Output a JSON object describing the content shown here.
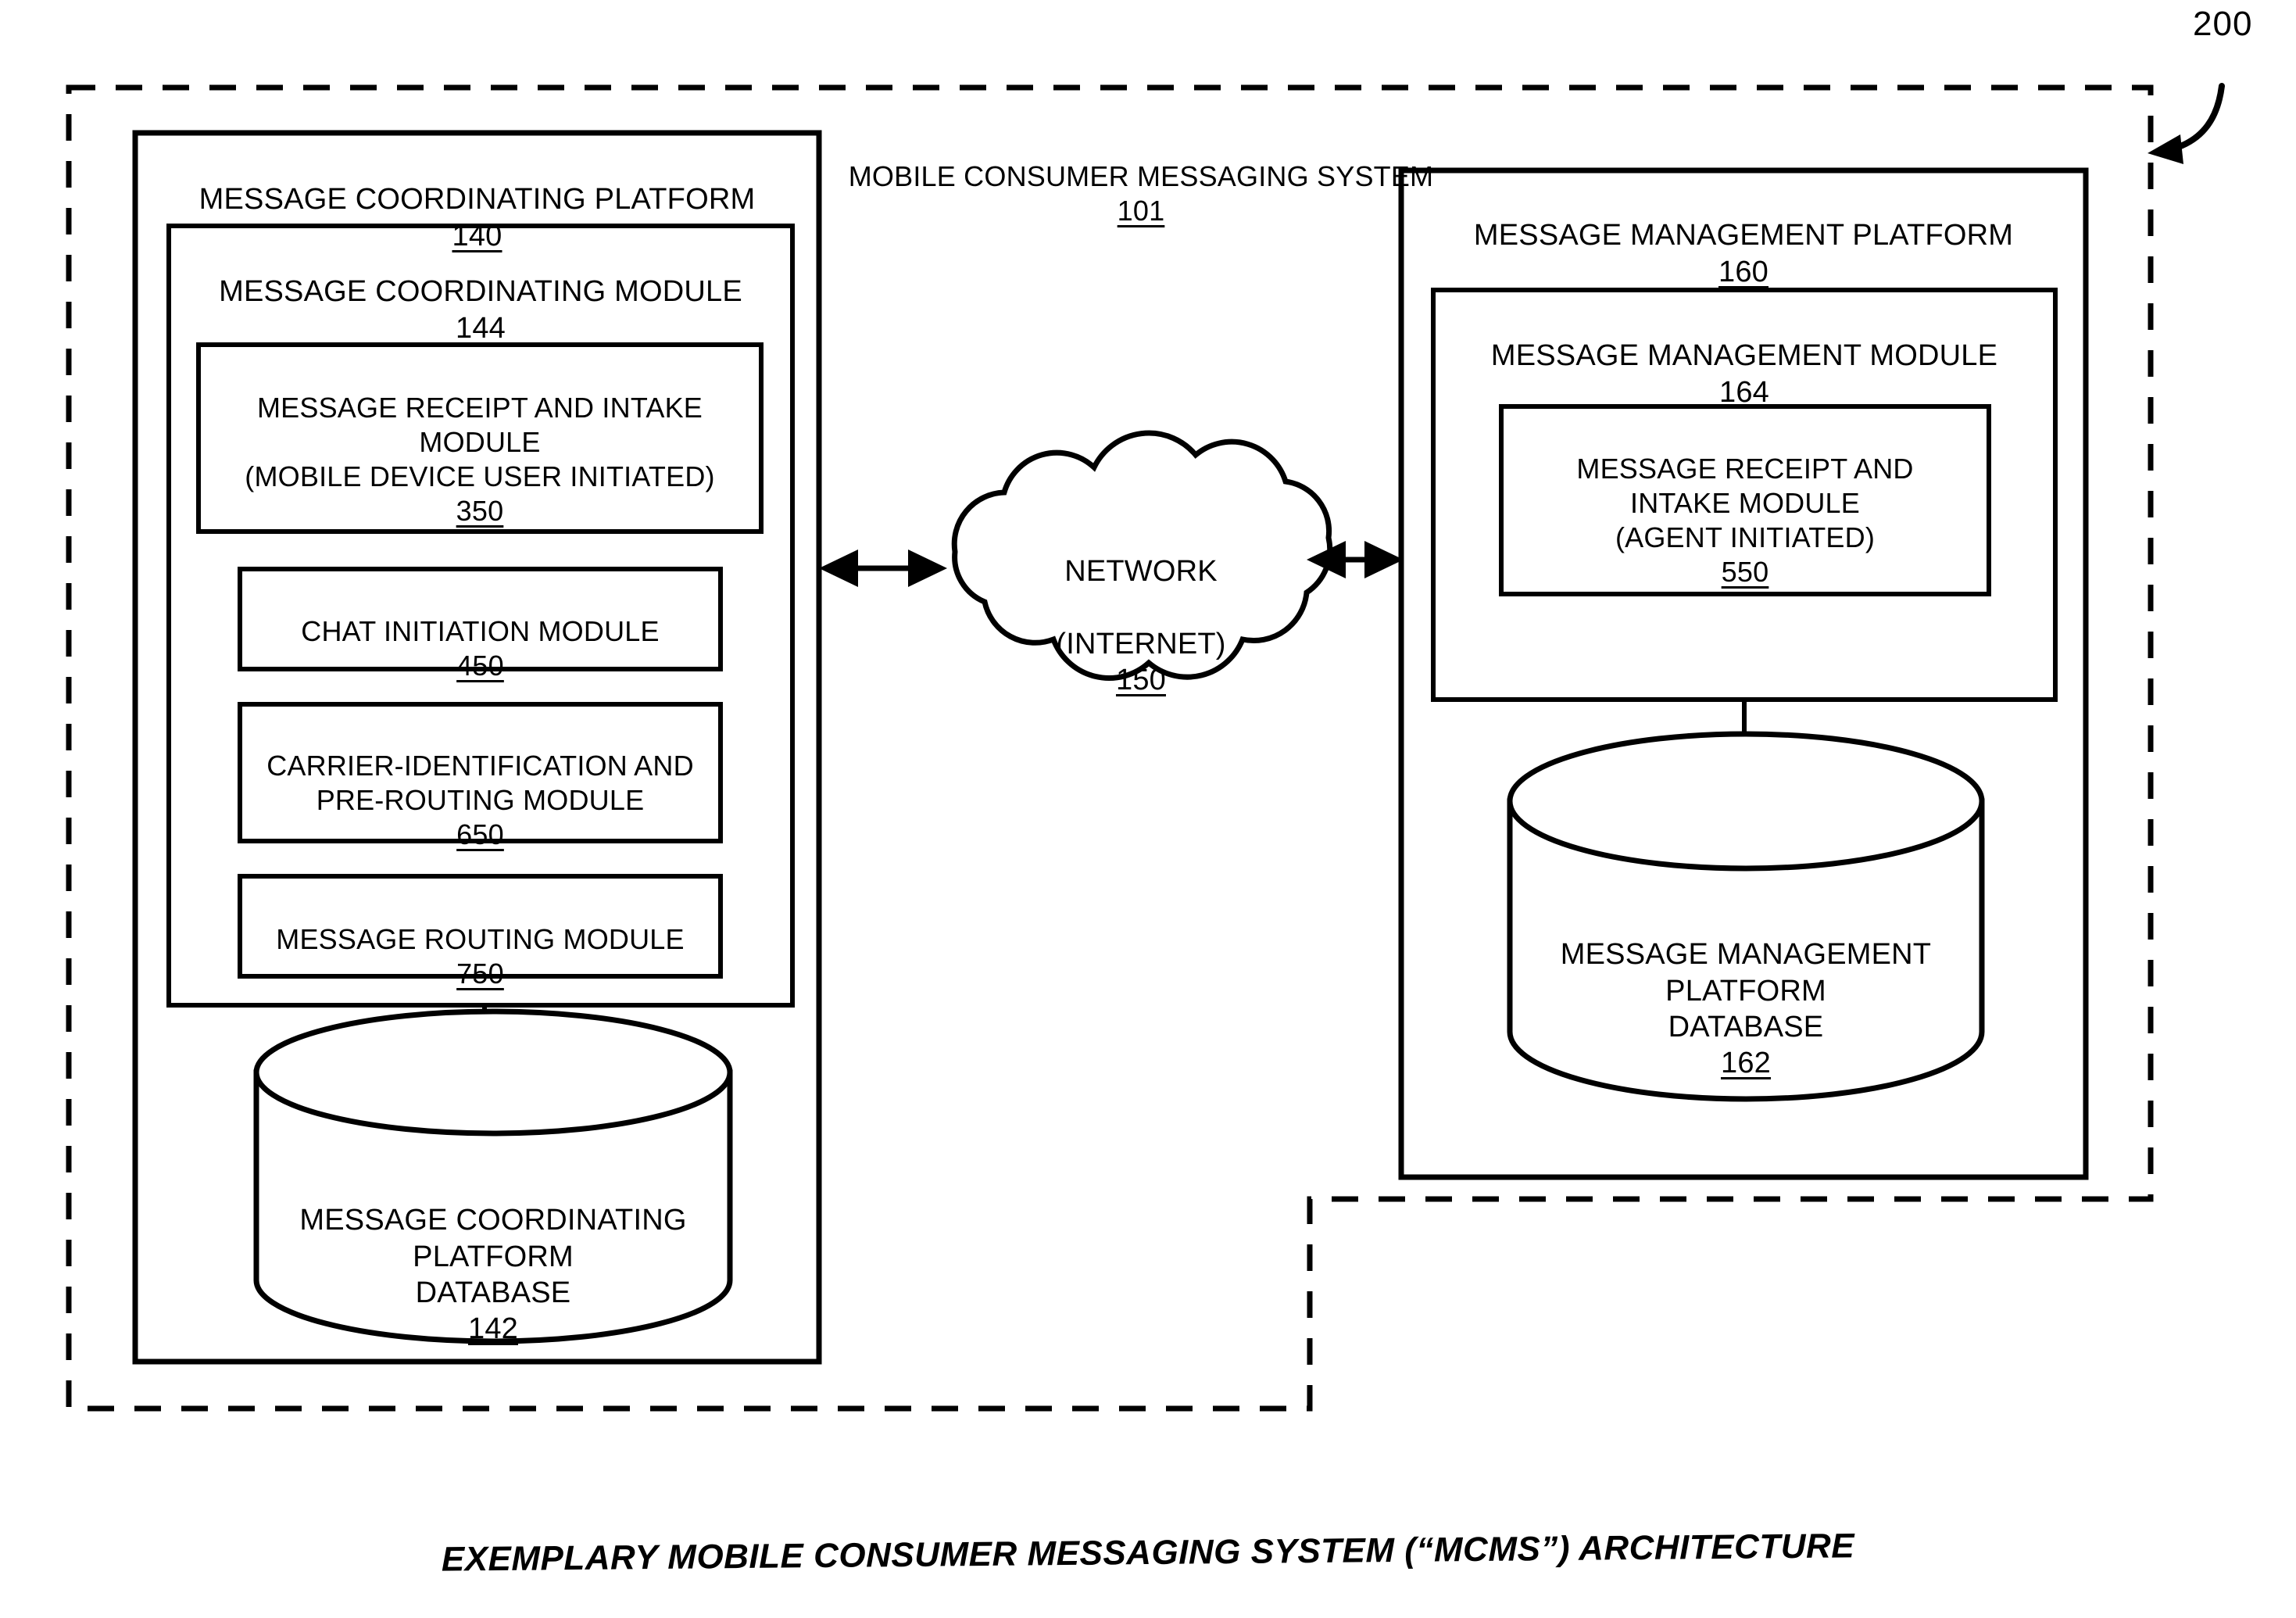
{
  "figure": {
    "reference_numeral": "200",
    "caption": "EXEMPLARY MOBILE CONSUMER MESSAGING SYSTEM (“MCMS”) ARCHITECTURE"
  },
  "system": {
    "title": "MOBILE CONSUMER MESSAGING SYSTEM",
    "numeral": "101"
  },
  "left_platform": {
    "title": "MESSAGE COORDINATING PLATFORM",
    "numeral": "140",
    "module": {
      "title": "MESSAGE COORDINATING MODULE",
      "numeral": "144",
      "submodules": [
        {
          "title": "MESSAGE RECEIPT AND INTAKE\nMODULE\n(MOBILE DEVICE USER INITIATED)",
          "numeral": "350"
        },
        {
          "title": "CHAT INITIATION MODULE",
          "numeral": "450"
        },
        {
          "title": "CARRIER-IDENTIFICATION AND\nPRE-ROUTING MODULE",
          "numeral": "650"
        },
        {
          "title": "MESSAGE ROUTING MODULE",
          "numeral": "750"
        }
      ]
    },
    "database": {
      "title": "MESSAGE COORDINATING\nPLATFORM\nDATABASE",
      "numeral": "142"
    }
  },
  "network": {
    "line1": "NETWORK",
    "line2": "(INTERNET)",
    "numeral": "150"
  },
  "right_platform": {
    "title": "MESSAGE MANAGEMENT PLATFORM",
    "numeral": "160",
    "module": {
      "title": "MESSAGE MANAGEMENT MODULE",
      "numeral": "164",
      "submodules": [
        {
          "title": "MESSAGE RECEIPT AND\nINTAKE MODULE\n(AGENT INITIATED)",
          "numeral": "550"
        }
      ]
    },
    "database": {
      "title": "MESSAGE MANAGEMENT\nPLATFORM\nDATABASE",
      "numeral": "162"
    }
  },
  "connectors": {
    "left_arrow_label": "bidirectional-arrow-platform-to-network",
    "right_arrow_label": "bidirectional-arrow-network-to-platform"
  },
  "colors": {
    "stroke": "#000000",
    "background": "#ffffff"
  }
}
